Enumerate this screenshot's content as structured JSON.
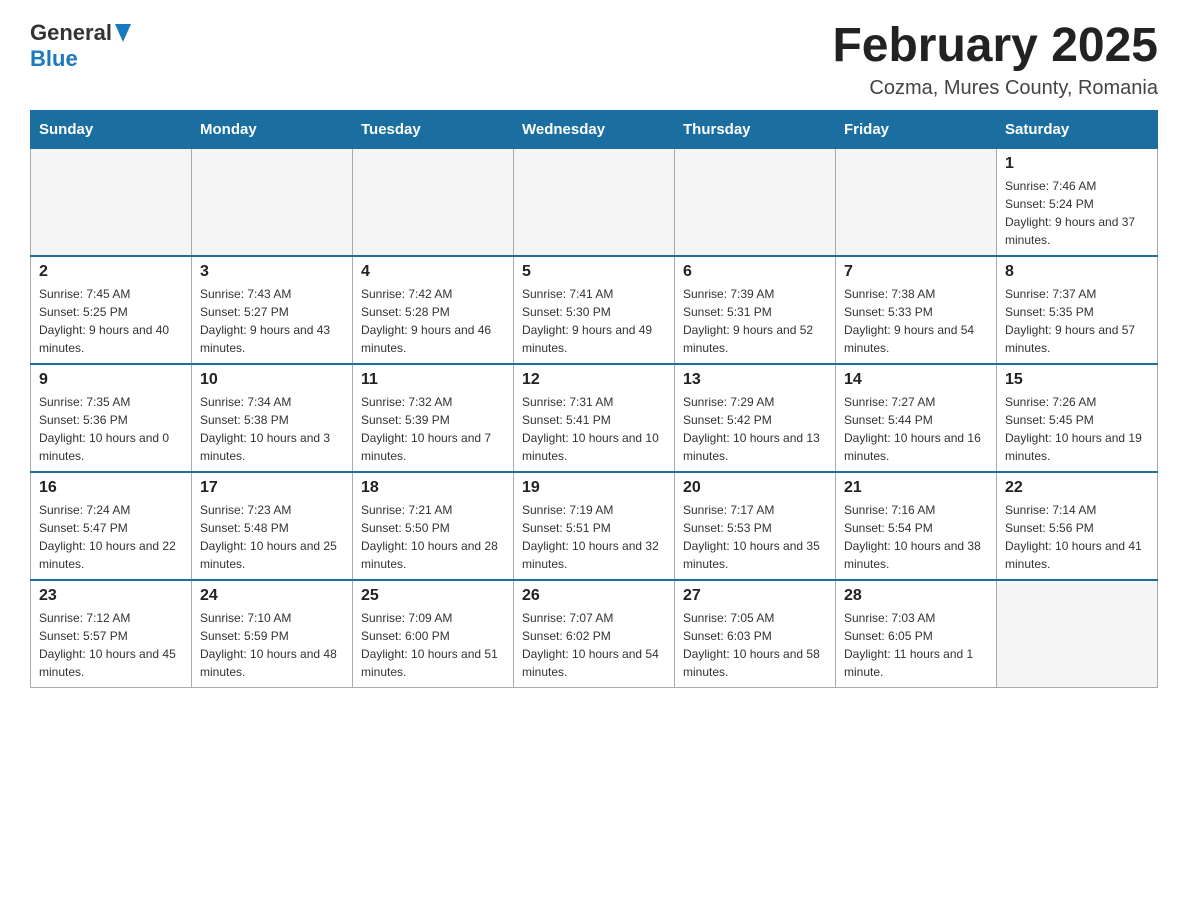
{
  "header": {
    "logo_general": "General",
    "logo_blue": "Blue",
    "month_title": "February 2025",
    "location": "Cozma, Mures County, Romania"
  },
  "calendar": {
    "days_of_week": [
      "Sunday",
      "Monday",
      "Tuesday",
      "Wednesday",
      "Thursday",
      "Friday",
      "Saturday"
    ],
    "weeks": [
      [
        {
          "day": "",
          "info": ""
        },
        {
          "day": "",
          "info": ""
        },
        {
          "day": "",
          "info": ""
        },
        {
          "day": "",
          "info": ""
        },
        {
          "day": "",
          "info": ""
        },
        {
          "day": "",
          "info": ""
        },
        {
          "day": "1",
          "info": "Sunrise: 7:46 AM\nSunset: 5:24 PM\nDaylight: 9 hours and 37 minutes."
        }
      ],
      [
        {
          "day": "2",
          "info": "Sunrise: 7:45 AM\nSunset: 5:25 PM\nDaylight: 9 hours and 40 minutes."
        },
        {
          "day": "3",
          "info": "Sunrise: 7:43 AM\nSunset: 5:27 PM\nDaylight: 9 hours and 43 minutes."
        },
        {
          "day": "4",
          "info": "Sunrise: 7:42 AM\nSunset: 5:28 PM\nDaylight: 9 hours and 46 minutes."
        },
        {
          "day": "5",
          "info": "Sunrise: 7:41 AM\nSunset: 5:30 PM\nDaylight: 9 hours and 49 minutes."
        },
        {
          "day": "6",
          "info": "Sunrise: 7:39 AM\nSunset: 5:31 PM\nDaylight: 9 hours and 52 minutes."
        },
        {
          "day": "7",
          "info": "Sunrise: 7:38 AM\nSunset: 5:33 PM\nDaylight: 9 hours and 54 minutes."
        },
        {
          "day": "8",
          "info": "Sunrise: 7:37 AM\nSunset: 5:35 PM\nDaylight: 9 hours and 57 minutes."
        }
      ],
      [
        {
          "day": "9",
          "info": "Sunrise: 7:35 AM\nSunset: 5:36 PM\nDaylight: 10 hours and 0 minutes."
        },
        {
          "day": "10",
          "info": "Sunrise: 7:34 AM\nSunset: 5:38 PM\nDaylight: 10 hours and 3 minutes."
        },
        {
          "day": "11",
          "info": "Sunrise: 7:32 AM\nSunset: 5:39 PM\nDaylight: 10 hours and 7 minutes."
        },
        {
          "day": "12",
          "info": "Sunrise: 7:31 AM\nSunset: 5:41 PM\nDaylight: 10 hours and 10 minutes."
        },
        {
          "day": "13",
          "info": "Sunrise: 7:29 AM\nSunset: 5:42 PM\nDaylight: 10 hours and 13 minutes."
        },
        {
          "day": "14",
          "info": "Sunrise: 7:27 AM\nSunset: 5:44 PM\nDaylight: 10 hours and 16 minutes."
        },
        {
          "day": "15",
          "info": "Sunrise: 7:26 AM\nSunset: 5:45 PM\nDaylight: 10 hours and 19 minutes."
        }
      ],
      [
        {
          "day": "16",
          "info": "Sunrise: 7:24 AM\nSunset: 5:47 PM\nDaylight: 10 hours and 22 minutes."
        },
        {
          "day": "17",
          "info": "Sunrise: 7:23 AM\nSunset: 5:48 PM\nDaylight: 10 hours and 25 minutes."
        },
        {
          "day": "18",
          "info": "Sunrise: 7:21 AM\nSunset: 5:50 PM\nDaylight: 10 hours and 28 minutes."
        },
        {
          "day": "19",
          "info": "Sunrise: 7:19 AM\nSunset: 5:51 PM\nDaylight: 10 hours and 32 minutes."
        },
        {
          "day": "20",
          "info": "Sunrise: 7:17 AM\nSunset: 5:53 PM\nDaylight: 10 hours and 35 minutes."
        },
        {
          "day": "21",
          "info": "Sunrise: 7:16 AM\nSunset: 5:54 PM\nDaylight: 10 hours and 38 minutes."
        },
        {
          "day": "22",
          "info": "Sunrise: 7:14 AM\nSunset: 5:56 PM\nDaylight: 10 hours and 41 minutes."
        }
      ],
      [
        {
          "day": "23",
          "info": "Sunrise: 7:12 AM\nSunset: 5:57 PM\nDaylight: 10 hours and 45 minutes."
        },
        {
          "day": "24",
          "info": "Sunrise: 7:10 AM\nSunset: 5:59 PM\nDaylight: 10 hours and 48 minutes."
        },
        {
          "day": "25",
          "info": "Sunrise: 7:09 AM\nSunset: 6:00 PM\nDaylight: 10 hours and 51 minutes."
        },
        {
          "day": "26",
          "info": "Sunrise: 7:07 AM\nSunset: 6:02 PM\nDaylight: 10 hours and 54 minutes."
        },
        {
          "day": "27",
          "info": "Sunrise: 7:05 AM\nSunset: 6:03 PM\nDaylight: 10 hours and 58 minutes."
        },
        {
          "day": "28",
          "info": "Sunrise: 7:03 AM\nSunset: 6:05 PM\nDaylight: 11 hours and 1 minute."
        },
        {
          "day": "",
          "info": ""
        }
      ]
    ]
  }
}
